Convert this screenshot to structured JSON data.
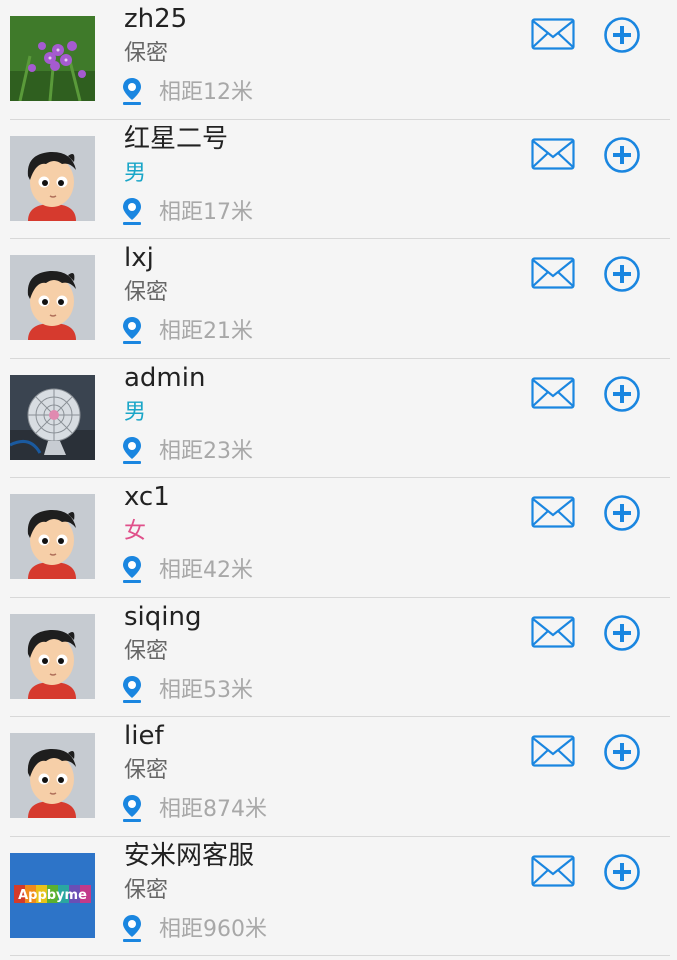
{
  "theme": {
    "accent": "#1a86e0",
    "text_primary": "#222222",
    "text_secondary": "#666666",
    "text_muted": "#a8a8a8",
    "male_color": "#1aa6c8",
    "female_color": "#e0508a",
    "background": "#f5f5f5"
  },
  "users": [
    {
      "name": "zh25",
      "gender": "保密",
      "gender_type": "secret",
      "distance": "相距12米",
      "avatar": "flower-photo"
    },
    {
      "name": "红星二号",
      "gender": "男",
      "gender_type": "male",
      "distance": "相距17米",
      "avatar": "cartoon-boy"
    },
    {
      "name": "lxj",
      "gender": "保密",
      "gender_type": "secret",
      "distance": "相距21米",
      "avatar": "cartoon-boy"
    },
    {
      "name": "admin",
      "gender": "男",
      "gender_type": "male",
      "distance": "相距23米",
      "avatar": "fan-photo"
    },
    {
      "name": "xc1",
      "gender": "女",
      "gender_type": "female",
      "distance": "相距42米",
      "avatar": "cartoon-boy"
    },
    {
      "name": "siqing",
      "gender": "保密",
      "gender_type": "secret",
      "distance": "相距53米",
      "avatar": "cartoon-boy"
    },
    {
      "name": "lief",
      "gender": "保密",
      "gender_type": "secret",
      "distance": "相距874米",
      "avatar": "cartoon-boy"
    },
    {
      "name": "安米网客服",
      "gender": "保密",
      "gender_type": "secret",
      "distance": "相距960米",
      "avatar": "appbyme-logo",
      "avatar_text": "Appbyme"
    }
  ]
}
